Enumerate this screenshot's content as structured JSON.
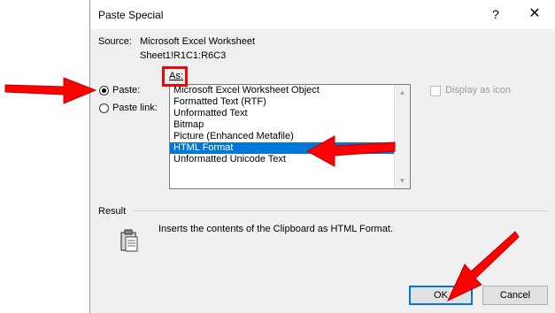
{
  "window": {
    "title": "Paste Special",
    "help_glyph": "?",
    "close_glyph": "✕"
  },
  "source": {
    "label": "Source:",
    "value": "Microsoft Excel Worksheet",
    "range": "Sheet1!R1C1:R6C3"
  },
  "options": {
    "paste_label": "Paste:",
    "paste_link_label": "Paste link:",
    "selected": "paste"
  },
  "as": {
    "label": "As:",
    "items": [
      "Microsoft Excel Worksheet Object",
      "Formatted Text (RTF)",
      "Unformatted Text",
      "Bitmap",
      "Picture (Enhanced Metafile)",
      "HTML Format",
      "Unformatted Unicode Text"
    ],
    "selected_index": 5
  },
  "display_as_icon": {
    "label": "Display as icon",
    "checked": false
  },
  "result": {
    "label": "Result",
    "text": "Inserts the contents of the Clipboard as HTML Format."
  },
  "buttons": {
    "ok": "OK",
    "cancel": "Cancel"
  },
  "annotations": {
    "color": "#ff0000"
  }
}
